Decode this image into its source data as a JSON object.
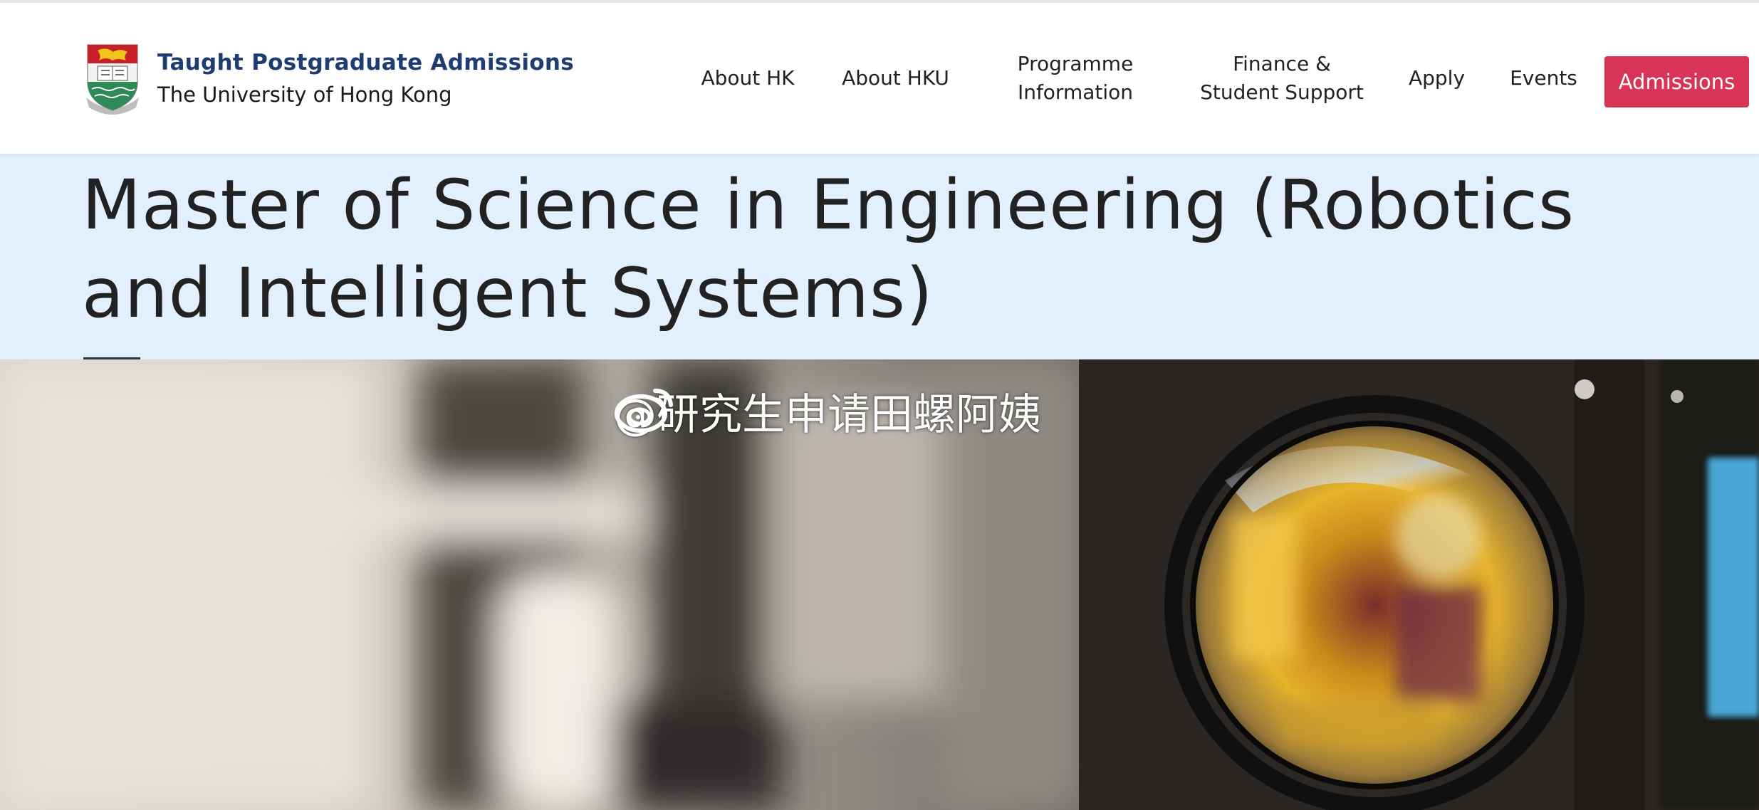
{
  "header": {
    "brand_title": "Taught Postgraduate Admissions",
    "brand_subtitle": "The University of Hong Kong",
    "logo_icon": "hku-crest-icon",
    "nav": {
      "about_hk": "About HK",
      "about_hku": "About HKU",
      "programme_line1": "Programme",
      "programme_line2": "Information",
      "finance_line1": "Finance &",
      "finance_line2": "Student Support",
      "apply": "Apply",
      "events": "Events",
      "admissions": "Admissions"
    }
  },
  "page": {
    "title": "Master of Science in Engineering (Robotics and Intelligent Systems)"
  },
  "hero": {
    "watermark_text": "@研究生申请田螺阿姨",
    "watermark_icon": "weibo-icon"
  },
  "colors": {
    "brand_navy": "#1f3d73",
    "accent_red": "#d93358",
    "title_band": "#e2f0fd",
    "text_dark": "#222222"
  }
}
